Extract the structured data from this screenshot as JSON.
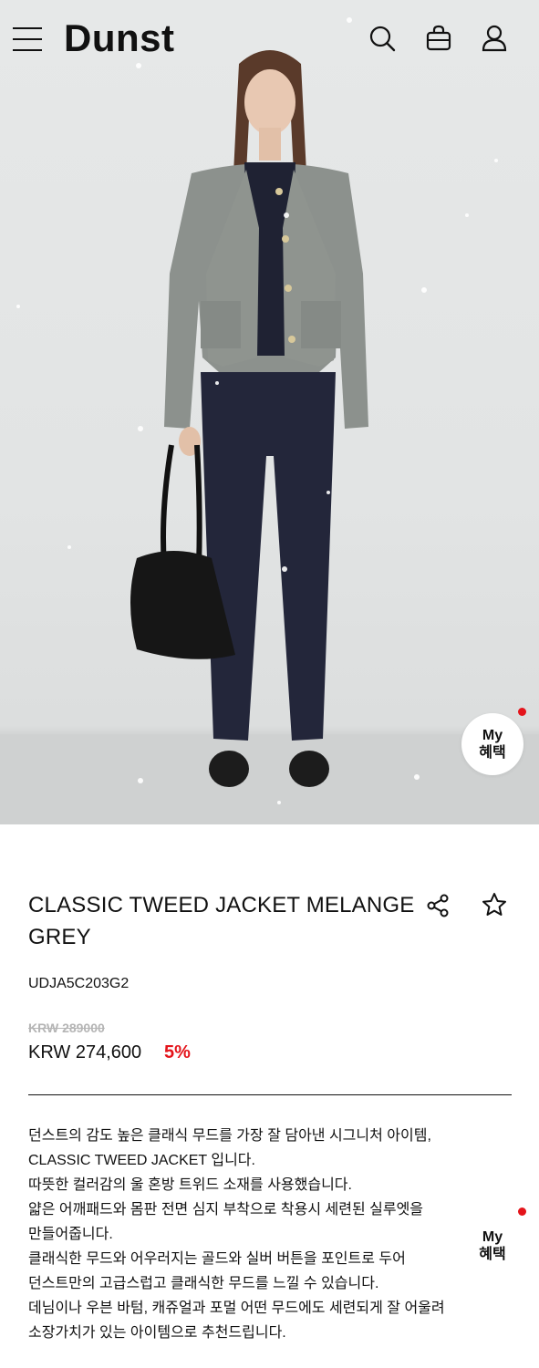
{
  "header": {
    "brand": "Dunst",
    "icons": [
      "menu-icon",
      "search-icon",
      "shopping-bag-icon",
      "user-icon"
    ]
  },
  "floating": {
    "my_line1": "My",
    "my_line2": "혜택"
  },
  "product": {
    "title": "CLASSIC TWEED JACKET MELANGE GREY",
    "sku": "UDJA5C203G2",
    "original_price": "KRW 289000",
    "sale_price": "KRW 274,600",
    "discount": "5%",
    "description": [
      "던스트의 감도 높은 클래식 무드를 가장 잘 담아낸 시그니처 아이템,",
      "CLASSIC TWEED JACKET 입니다.",
      "따뜻한 컬러감의 울 혼방 트위드 소재를 사용했습니다.",
      "얇은 어깨패드와 몸판 전면 심지 부착으로 착용시 세련된 실루엣을",
      "만들어줍니다.",
      "클래식한 무드와 어우러지는 골드와 실버 버튼을 포인트로 두어",
      "던스트만의 고급스럽고 클래식한 무드를 느낄 수 있습니다.",
      "데님이나 우븐 바텀, 캐쥬얼과 포멀 어떤 무드에도 세련되게 잘 어울려",
      "소장가치가 있는 아이템으로 추천드립니다."
    ]
  },
  "colors": {
    "accent_red": "#e4141b",
    "text": "#111111",
    "muted": "#b5b5b5"
  }
}
